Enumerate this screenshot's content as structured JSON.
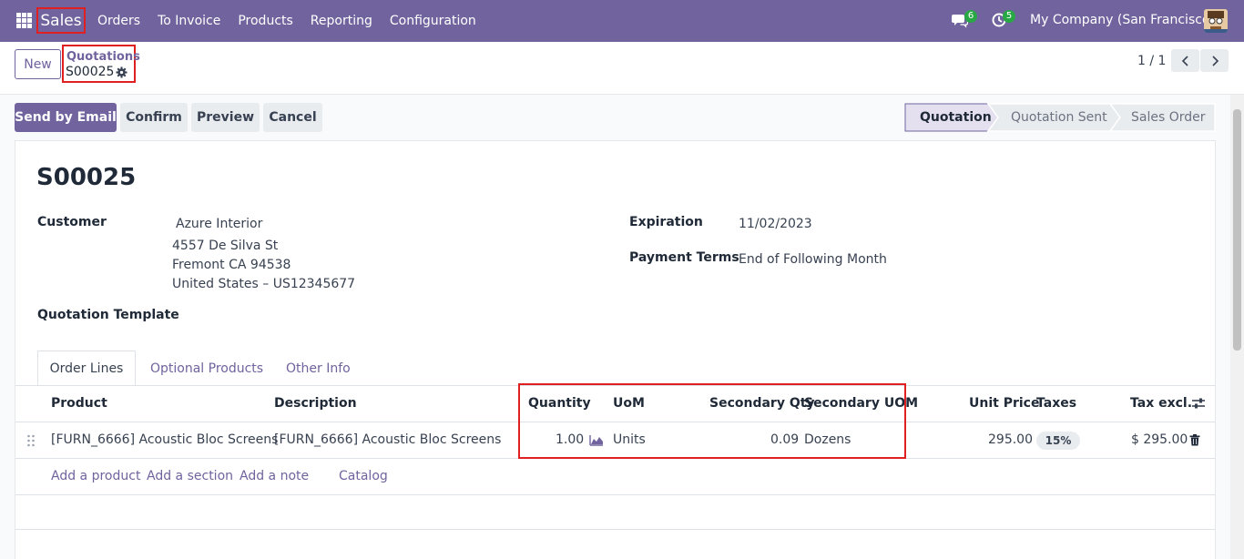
{
  "navbar": {
    "app_name": "Sales",
    "menu": [
      "Orders",
      "To Invoice",
      "Products",
      "Reporting",
      "Configuration"
    ],
    "chat_count": "6",
    "activity_count": "5",
    "company": "My Company (San Francisco)"
  },
  "control": {
    "new_label": "New",
    "breadcrumb_parent": "Quotations",
    "breadcrumb_current": "S00025",
    "pager": "1 / 1"
  },
  "actions": {
    "send_by_email": "Send by Email",
    "confirm": "Confirm",
    "preview": "Preview",
    "cancel": "Cancel"
  },
  "statusbar": [
    "Quotation",
    "Quotation Sent",
    "Sales Order"
  ],
  "record": {
    "title": "S00025",
    "customer_label": "Customer",
    "customer_name": "Azure Interior",
    "customer_address": [
      "4557 De Silva St",
      "Fremont CA 94538",
      "United States – US12345677"
    ],
    "expiration_label": "Expiration",
    "expiration_value": "11/02/2023",
    "payment_terms_label": "Payment Terms",
    "payment_terms_value": "End of Following Month",
    "template_label": "Quotation Template"
  },
  "tabs": [
    "Order Lines",
    "Optional Products",
    "Other Info"
  ],
  "table": {
    "columns": [
      "Product",
      "Description",
      "Quantity",
      "UoM",
      "Secondary Qty",
      "Secondary UOM",
      "Unit Price",
      "Taxes",
      "Tax excl."
    ],
    "rows": [
      {
        "product": "[FURN_6666] Acoustic Bloc Screens",
        "description": "[FURN_6666] Acoustic Bloc Screens",
        "quantity": "1.00",
        "uom": "Units",
        "secondary_qty": "0.09",
        "secondary_uom": "Dozens",
        "unit_price": "295.00",
        "taxes": "15%",
        "tax_excl": "$ 295.00"
      }
    ],
    "add_links": [
      "Add a product",
      "Add a section",
      "Add a note",
      "Catalog"
    ]
  },
  "colors": {
    "brand": "#71639e",
    "highlight": "#e02020"
  }
}
